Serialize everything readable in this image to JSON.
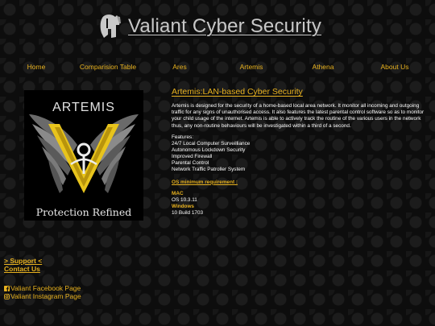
{
  "header": {
    "title": "Valiant Cyber Security",
    "logo_icon": "spartan-helmet-icon"
  },
  "nav": [
    "Home",
    "Comparision Table",
    "Ares",
    "Artemis",
    "Athena",
    "About Us"
  ],
  "product": {
    "image_brand": "ARTEMIS",
    "image_tagline": "Protection Refined",
    "heading": "Artemis:LAN-based Cyber Security",
    "description": "Artemis is designed for the security of a home-based local area network. It monitor all incoming and outgoing traffic for any signs of unauthorised access. It also features the latest parental control software so as to monitor your child usage of the internet. Artemis is able to actively track the routine of the various users in the network thus, any non-routine behaviours will be investigated within a third of a second.",
    "features_title": "Features:",
    "features": [
      "24/7 Local Computer Surveilliance",
      "Autonomous Lockdown Security",
      "Improved Firewall",
      "Parental Control",
      "Network Traffic Patroller System"
    ],
    "requirements_title": "OS minimum requirement :",
    "requirements": [
      {
        "os": "MAC",
        "version": "OS 10.3.11"
      },
      {
        "os": "Windows",
        "version": "10 Build 1703"
      }
    ]
  },
  "footer": {
    "support": "> Support <",
    "contact": "Contact Us",
    "facebook": "Valiant Facebook Page",
    "instagram": "Valiant Instagram Page"
  },
  "colors": {
    "accent": "#e8b21f",
    "background": "#0d0d0d",
    "title": "#c8c8c8"
  }
}
